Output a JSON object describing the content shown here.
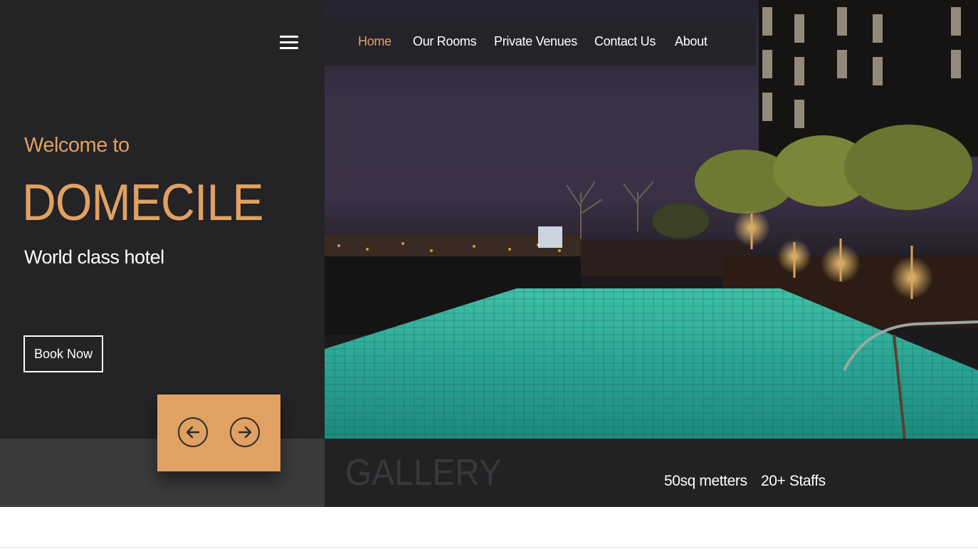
{
  "header": {
    "menu_icon": "hamburger-icon",
    "nav": [
      {
        "label": "Home",
        "active": true
      },
      {
        "label": "Our Rooms",
        "active": false
      },
      {
        "label": "Private Venues",
        "active": false
      },
      {
        "label": "Contact Us",
        "active": false
      },
      {
        "label": "About",
        "active": false
      }
    ]
  },
  "hero": {
    "welcome": "Welcome to",
    "brand": "DOMECILE",
    "tagline": "World class hotel",
    "cta_label": "Book Now",
    "image_alt": "Night rooftop pool with city lights",
    "prev_icon": "arrow-left-circle-icon",
    "next_icon": "arrow-right-circle-icon"
  },
  "footer_bar": {
    "section_title": "GALLERY",
    "stats": [
      "50sq metters",
      "20+ Staffs"
    ]
  },
  "colors": {
    "accent": "#e0a162",
    "panel": "#242325",
    "panel_bottom": "#3b3a3c",
    "bar": "#222124",
    "gallery_text": "#383739"
  }
}
